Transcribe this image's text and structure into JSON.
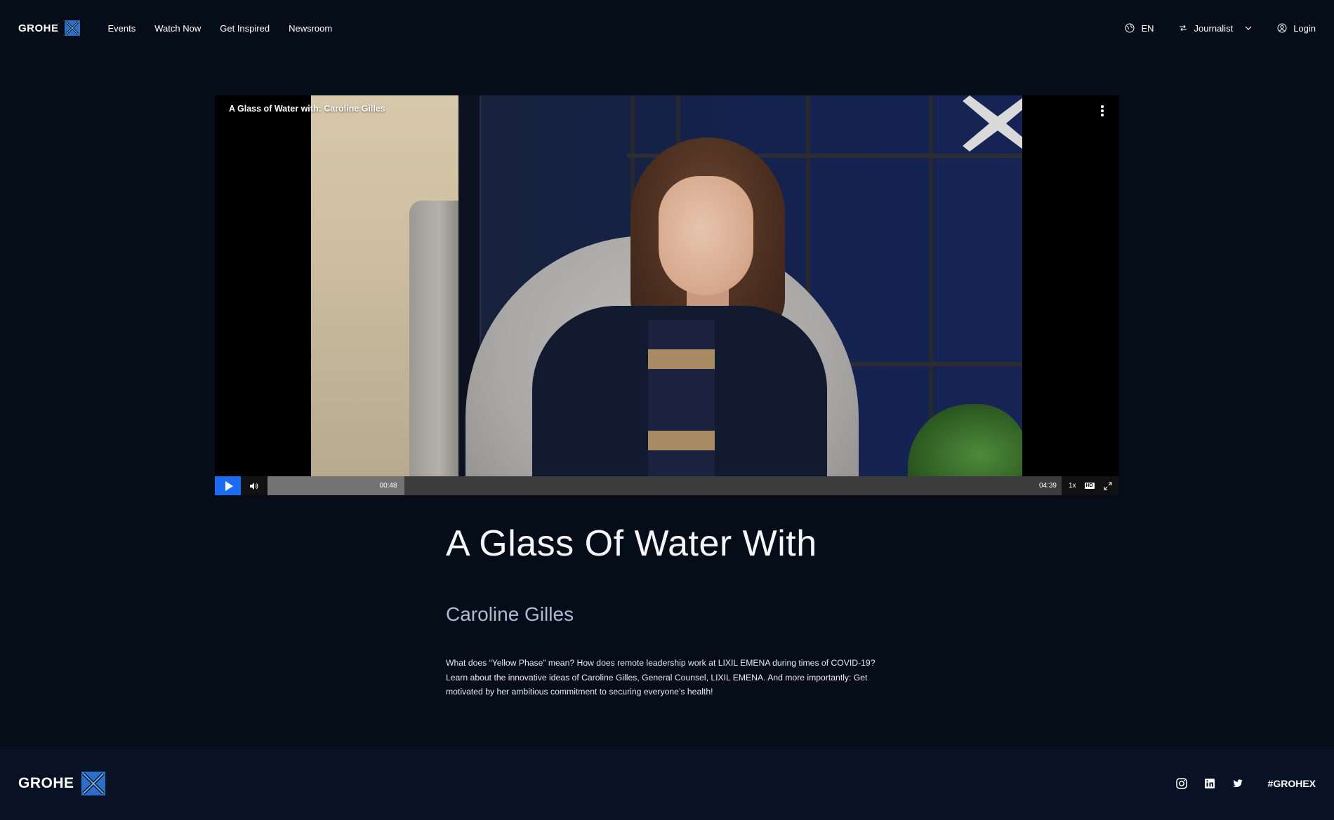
{
  "header": {
    "logo_text": "GROHE",
    "nav": [
      "Events",
      "Watch Now",
      "Get Inspired",
      "Newsroom"
    ],
    "language": "EN",
    "role": "Journalist",
    "login": "Login"
  },
  "player": {
    "video_title": "A Glass of Water with: Caroline Gilles",
    "current_time": "00:48",
    "duration": "04:39",
    "progress_fraction": 0.172,
    "speed": "1x",
    "quality_badge": "HD"
  },
  "content": {
    "title": "A Glass Of Water With",
    "subtitle": "Caroline Gilles",
    "description": "What does “Yellow Phase” mean? How does remote leadership work at LIXIL EMENA during times of COVID-19? Learn about the innovative ideas of Caroline Gilles, General Counsel,  LIXIL  EMENA.  And  more importantly: Get motivated by her ambitious commitment to securing everyone’s health!"
  },
  "footer": {
    "logo_text": "GROHE",
    "hashtag": "#GROHEX",
    "social_icons": [
      "instagram-icon",
      "linkedin-icon",
      "twitter-icon"
    ]
  },
  "colors": {
    "background": "#050d19",
    "footer_background": "#081224",
    "accent_blue": "#1a6cf5",
    "logo_blue": "#2a6fc9"
  }
}
